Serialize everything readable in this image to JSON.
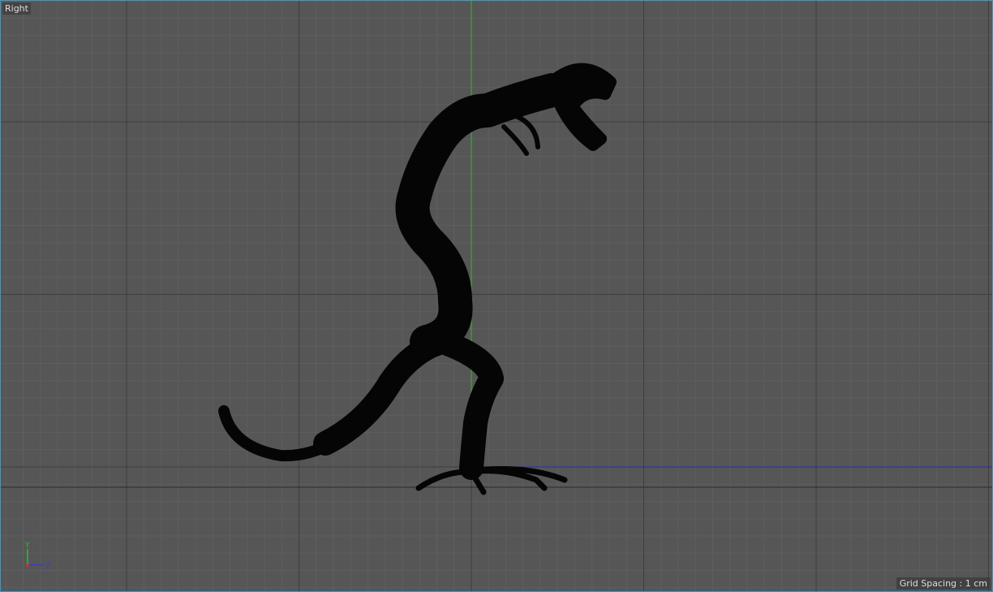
{
  "viewport": {
    "view_name": "Right",
    "grid_spacing_label": "Grid Spacing : 1 cm",
    "axis_labels": {
      "y": "Y",
      "z": "Z"
    },
    "colors": {
      "background": "#565656",
      "border": "#2a9fd8",
      "y_axis": "#3cb03c",
      "z_axis": "#2a2ab0",
      "silhouette": "#050505"
    }
  }
}
